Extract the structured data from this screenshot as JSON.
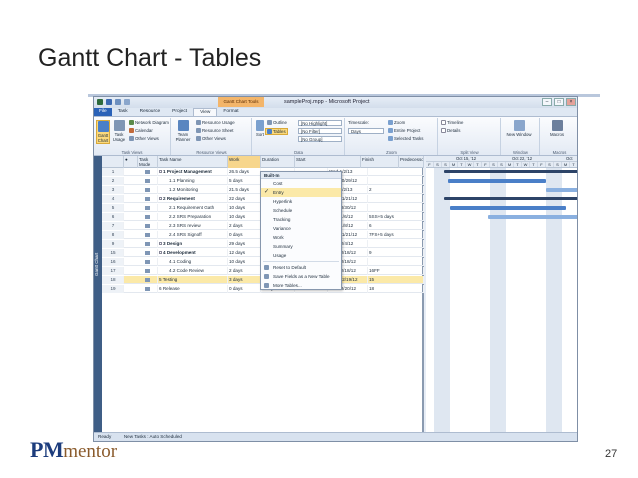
{
  "slide": {
    "title": "Gantt Chart - Tables",
    "page_number": "27",
    "logo_main": "PM",
    "logo_sub": "mentor"
  },
  "app": {
    "window_title": "sampleProj.mpp - Microsoft Project",
    "context_tab": "Gantt Chart Tools",
    "ribbon_tabs": [
      "File",
      "Task",
      "Resource",
      "Project",
      "View",
      "Format"
    ],
    "active_tab": "View",
    "ribbon": {
      "task_views_label": "Task Views",
      "resource_views_label": "Resource Views",
      "data_label": "Data",
      "zoom_label": "Zoom",
      "split_view_label": "Split View",
      "window_label": "Window",
      "macros_label": "Macros",
      "gantt_chart": "Gantt Chart",
      "task_usage": "Task Usage",
      "network_diagram": "Network Diagram",
      "calendar": "Calendar",
      "other_views": "Other Views",
      "team_planner": "Team Planner",
      "resource_usage": "Resource Usage",
      "resource_sheet": "Resource Sheet",
      "other_views_2": "Other Views",
      "sort": "Sort",
      "outline": "Outline",
      "tables": "Tables",
      "highlight": "[No Highlight]",
      "filter": "[No Filter]",
      "group": "[No Group]",
      "timescale_label": "Timescale:",
      "timescale_value": "Days",
      "zoom": "Zoom",
      "entire_project": "Entire Project",
      "selected_tasks": "Selected Tasks",
      "timeline": "Timeline",
      "details": "Details",
      "new_window": "New Window",
      "macros": "Macros"
    },
    "sidebar_label": "Gantt Chart",
    "columns": [
      "Task Mode",
      "Task Name",
      "Work",
      "Duration",
      "Start",
      "Finish",
      "Predecessors"
    ],
    "rows": [
      {
        "id": "1",
        "name": "1 Project Management",
        "work": "26.5 days",
        "dur": "",
        "start": "",
        "finish": "Wed 1/2/13",
        "pred": "",
        "bold": true,
        "indent": 0,
        "group": true
      },
      {
        "id": "2",
        "name": "1.1 Planning",
        "work": "5 days",
        "dur": "",
        "start": "",
        "finish": "Mon 10/29/12",
        "pred": "",
        "bold": false,
        "indent": 1,
        "group": false
      },
      {
        "id": "3",
        "name": "1.2 Monitoring",
        "work": "21.5 days",
        "dur": "",
        "start": "",
        "finish": "Wed 1/2/13",
        "pred": "2",
        "bold": false,
        "indent": 1,
        "group": false
      },
      {
        "id": "4",
        "name": "2 Requirement",
        "work": "22 days",
        "dur": "",
        "start": "",
        "finish": "Wed 11/21/12",
        "pred": "",
        "bold": true,
        "indent": 0,
        "group": true
      },
      {
        "id": "5",
        "name": "2.1 Requirement Gath",
        "work": "10 days",
        "dur": "",
        "start": "",
        "finish": "Tue 10/30/12",
        "pred": "",
        "bold": false,
        "indent": 1,
        "group": false
      },
      {
        "id": "6",
        "name": "2.2 SRS Preparation",
        "work": "10 days",
        "dur": "",
        "start": "",
        "finish": "Tue 11/6/12",
        "pred": "5SS+5 days",
        "bold": false,
        "indent": 1,
        "group": false
      },
      {
        "id": "7",
        "name": "2.3 SRS review",
        "work": "2 days",
        "dur": "",
        "start": "",
        "finish": "Thu 11/8/12",
        "pred": "6",
        "bold": false,
        "indent": 1,
        "group": false
      },
      {
        "id": "8",
        "name": "2.4 SRS Signoff",
        "work": "0 days",
        "dur": "",
        "start": "",
        "finish": "Wed 11/21/12",
        "pred": "7FS+5 days",
        "bold": false,
        "indent": 1,
        "group": false
      },
      {
        "id": "9",
        "name": "3 Design",
        "work": "29 days",
        "dur": "",
        "start": "",
        "finish": "Tue 12/4/12",
        "pred": "",
        "bold": true,
        "indent": 0,
        "group": true
      },
      {
        "id": "15",
        "name": "4 Development",
        "work": "12 days",
        "dur": "",
        "start": "",
        "finish": "Tue 12/18/12",
        "pred": "9",
        "bold": true,
        "indent": 0,
        "group": true
      },
      {
        "id": "16",
        "name": "4.1 Coding",
        "work": "10 days",
        "dur": "",
        "start": "",
        "finish": "Tue 12/18/12",
        "pred": "",
        "bold": false,
        "indent": 1,
        "group": false
      },
      {
        "id": "17",
        "name": "4.2 Code Review",
        "work": "2 days",
        "dur": "2 days?",
        "start": "Fri 12/14/12",
        "finish": "Tue 12/18/12",
        "pred": "16FF",
        "bold": false,
        "indent": 1,
        "group": false
      },
      {
        "id": "18",
        "name": "5 Testing",
        "work": "3 days",
        "dur": "3.5 days?",
        "start": "Tue 12/18/12",
        "finish": "Wed 12/19/12",
        "pred": "15",
        "bold": false,
        "indent": 0,
        "group": false,
        "selected": true
      },
      {
        "id": "19",
        "name": "6 Release",
        "work": "0 days",
        "dur": "1 day?",
        "start": "Tue 12/20/12",
        "finish": "Thu 12/20/12",
        "pred": "18",
        "bold": false,
        "indent": 0,
        "group": false
      }
    ],
    "tables_menu": {
      "header": "Built-In",
      "items": [
        "Cost",
        "Entry",
        "Hyperlink",
        "Schedule",
        "Tracking",
        "Variance",
        "Work",
        "Summary",
        "Usage"
      ],
      "checked": "Entry",
      "actions": [
        "Reset to Default",
        "Save Fields as a New Table",
        "More Tables..."
      ]
    },
    "timescale": {
      "weeks": [
        "Oct 15, '12",
        "Oct 22, '12",
        "Oct 29, '12"
      ],
      "days": [
        "F",
        "S",
        "S",
        "M",
        "T",
        "W",
        "T",
        "F",
        "S",
        "S",
        "M",
        "T",
        "W",
        "T",
        "F",
        "S",
        "S",
        "M",
        "T"
      ]
    },
    "status": {
      "ready": "Ready",
      "new_tasks": "New Tasks : Auto Scheduled"
    },
    "colors": {
      "file_tab": "#2a62b8",
      "summary_bar": "#2d4468",
      "task_bar": "#4a7fc8",
      "highlight": "#fbd97b"
    }
  }
}
